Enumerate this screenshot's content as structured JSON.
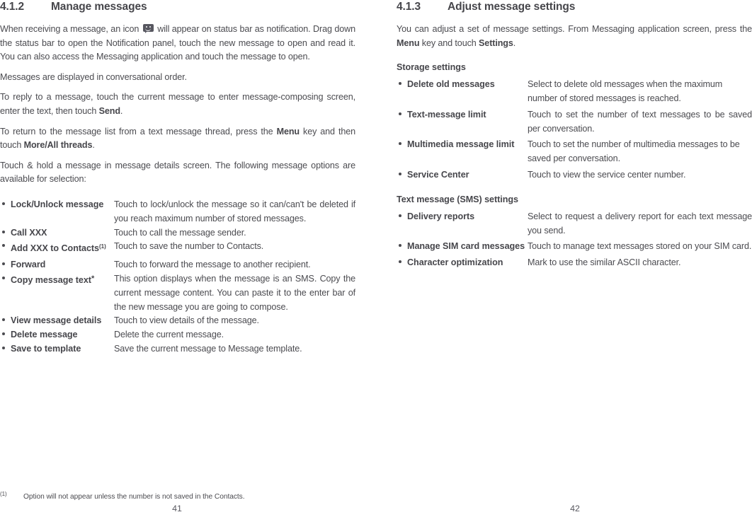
{
  "left_page": {
    "section": {
      "number": "4.1.2",
      "title": "Manage messages"
    },
    "paragraphs": {
      "p1_a": "When receiving a message, an icon ",
      "p1_icon": "message-smiley-icon",
      "p1_b": " will appear on status bar as notification. Drag down the status bar to open the Notification panel, touch the new message to open and read it. You can also access the Messaging application and touch the message to open.",
      "p2": "Messages are displayed in conversational order.",
      "p3_a": "To reply to a message, touch the current message to enter message-composing screen, enter the text, then touch ",
      "p3_b": "Send",
      "p3_c": ".",
      "p4_a": "To return to the message list from a text message thread, press the ",
      "p4_b": "Menu",
      "p4_c": " key and then touch ",
      "p4_d": "More/All threads",
      "p4_e": ".",
      "p5": "Touch & hold a message in message details screen. The following message options are available for selection:"
    },
    "options": [
      {
        "term": "Lock/Unlock message",
        "desc": "Touch to lock/unlock the message so it can/can't be deleted if you reach maximum number of stored messages."
      },
      {
        "term": "Call XXX",
        "desc": "Touch to call the message sender."
      },
      {
        "term": "Add XXX to Contacts",
        "term_sup": "(1)",
        "desc": "Touch to save the number to Contacts."
      },
      {
        "term": "Forward",
        "desc": "Touch to forward the message to another recipient."
      },
      {
        "term": "Copy message text",
        "term_sup": "*",
        "desc": "This option displays when the message is an SMS. Copy the current message content. You can paste it to the enter bar of the new message you are going to compose."
      },
      {
        "term": "View message details",
        "desc": "Touch to view details of the message."
      },
      {
        "term": "Delete message",
        "desc": "Delete the current message."
      },
      {
        "term": "Save to template",
        "desc": "Save the current message to Message template."
      }
    ],
    "footnote": {
      "mark": "(1)",
      "text": "Option will not appear unless the number is not saved in the Contacts."
    },
    "page_number": "41"
  },
  "right_page": {
    "section": {
      "number": "4.1.3",
      "title": "Adjust message settings"
    },
    "intro": {
      "a": "You can adjust a set of message settings. From Messaging application screen, press the ",
      "b": "Menu",
      "c": " key and touch ",
      "d": "Settings",
      "e": "."
    },
    "storage": {
      "heading": "Storage settings",
      "items": [
        {
          "term": "Delete old messages",
          "desc": "Select to delete old messages when the maximum number of stored messages is reached."
        },
        {
          "term": "Text-message limit",
          "desc": "Touch to set the number of text messages to be saved per conversation."
        },
        {
          "term": "Multimedia message limit",
          "desc": "Touch to set the number of multimedia messages to be saved per conversation."
        },
        {
          "term": "Service Center",
          "desc": "Touch to view the service center number."
        }
      ]
    },
    "sms": {
      "heading": "Text message (SMS) settings",
      "items": [
        {
          "term": "Delivery reports",
          "desc": "Select to request a delivery report for each text message you send."
        },
        {
          "term": "Manage SIM card messages",
          "desc": "Touch to manage text messages stored on your SIM card."
        },
        {
          "term": "Character optimization",
          "desc": "Mark to use the similar ASCII character."
        }
      ]
    },
    "page_number": "42"
  },
  "colors": {
    "text": "#4b4b50",
    "heading": "#46464b",
    "icon": "#575760",
    "background": "#ffffff"
  }
}
